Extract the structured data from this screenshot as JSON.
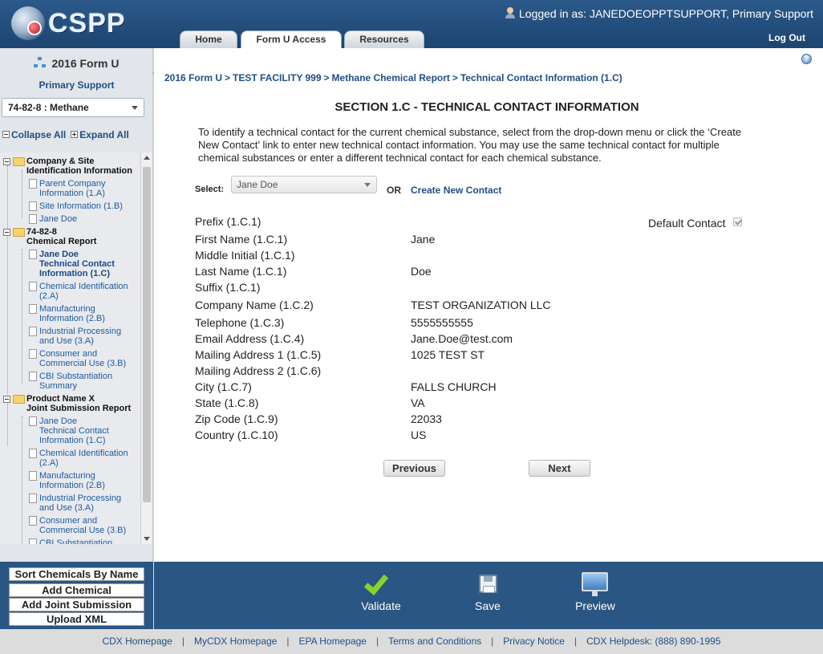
{
  "header": {
    "logo_text": "CSPP",
    "logged_in_as": "Logged in as: JANEDOEOPPTSUPPORT, Primary Support",
    "logout": "Log Out",
    "tabs": [
      {
        "label": "Home",
        "active": false
      },
      {
        "label": "Form U Access",
        "active": true
      },
      {
        "label": "Resources",
        "active": false
      }
    ]
  },
  "sidebar": {
    "title": "2016 Form U",
    "subtitle": "Primary Support",
    "chemical_selected": "74-82-8 : Methane",
    "collapse_all": "Collapse All",
    "expand_all": "Expand All",
    "tree": {
      "g1_line1": "Company & Site",
      "g1_line2": "Identification Information",
      "g1_items": [
        [
          "Parent Company",
          "Information (1.A)"
        ],
        [
          "Site Information (1.B)"
        ],
        [
          "Jane Doe"
        ]
      ],
      "g2_line1": "74-82-8",
      "g2_line2": "Chemical Report",
      "g2_items": [
        [
          "Jane Doe",
          "Technical Contact",
          "Information (1.C)"
        ],
        [
          "Chemical Identification",
          "(2.A)"
        ],
        [
          "Manufacturing",
          "Information (2.B)"
        ],
        [
          "Industrial Processing",
          "and Use (3.A)"
        ],
        [
          "Consumer and",
          "Commercial Use (3.B)"
        ],
        [
          "CBI Substantiation",
          "Summary"
        ]
      ],
      "g3_line1": "Product Name X",
      "g3_line2": "Joint Submission Report",
      "g3_items": [
        [
          "Jane Doe",
          "Technical Contact",
          "Information (1.C)"
        ],
        [
          "Chemical Identification",
          "(2.A)"
        ],
        [
          "Manufacturing",
          "Information (2.B)"
        ],
        [
          "Industrial Processing",
          "and Use (3.A)"
        ],
        [
          "Consumer and",
          "Commercial Use (3.B)"
        ],
        [
          "CBI Substantiation"
        ]
      ]
    },
    "buttons": [
      "Sort Chemicals By Name",
      "Add Chemical",
      "Add Joint Submission",
      "Upload XML"
    ]
  },
  "breadcrumb": [
    "2016 Form U",
    "TEST FACILITY 999",
    "Methane Chemical Report",
    "Technical Contact Information (1.C)"
  ],
  "breadcrumb_separator": ">",
  "section_title": "SECTION 1.C - TECHNICAL CONTACT INFORMATION",
  "instructions": "To identify a technical contact for the current chemical substance, select from the drop-down menu or click the ‘Create New Contact’ link to enter new technical contact information. You may use the same technical contact for multiple chemical substances or enter a different technical contact for each chemical substance.",
  "select_label": "Select:",
  "select_value": "Jane Doe",
  "or_label": "OR",
  "create_link": "Create New Contact",
  "default_contact_label": "Default Contact",
  "default_contact_checked": true,
  "fields": [
    {
      "label": "Prefix (1.C.1)",
      "value": ""
    },
    {
      "label": "First Name (1.C.1)",
      "value": "Jane"
    },
    {
      "label": "Middle Initial (1.C.1)",
      "value": ""
    },
    {
      "label": "Last Name (1.C.1)",
      "value": "Doe"
    },
    {
      "label": "Suffix (1.C.1)",
      "value": ""
    },
    {
      "label": "Company Name (1.C.2)",
      "value": "TEST ORGANIZATION LLC"
    },
    {
      "label": "Telephone (1.C.3)",
      "value": "5555555555"
    },
    {
      "label": "Email Address (1.C.4)",
      "value": "Jane.Doe@test.com"
    },
    {
      "label": "Mailing Address 1 (1.C.5)",
      "value": "1025 TEST ST"
    },
    {
      "label": "Mailing Address 2 (1.C.6)",
      "value": ""
    },
    {
      "label": "City (1.C.7)",
      "value": "FALLS CHURCH"
    },
    {
      "label": "State (1.C.8)",
      "value": "VA"
    },
    {
      "label": "Zip Code (1.C.9)",
      "value": "22033"
    },
    {
      "label": "Country (1.C.10)",
      "value": "US"
    }
  ],
  "nav": {
    "previous": "Previous",
    "next": "Next"
  },
  "actions": {
    "validate": "Validate",
    "save": "Save",
    "preview": "Preview"
  },
  "footer": {
    "links": [
      "CDX Homepage",
      "MyCDX Homepage",
      "EPA Homepage",
      "Terms and Conditions",
      "Privacy Notice",
      "CDX Helpdesk: (888) 890-1995"
    ],
    "separator": "|"
  },
  "colors": {
    "header_blue": "#1d4470",
    "link_blue": "#1f4e86",
    "action_bar": "#2a5684",
    "validate_green": "#8bd12c"
  }
}
